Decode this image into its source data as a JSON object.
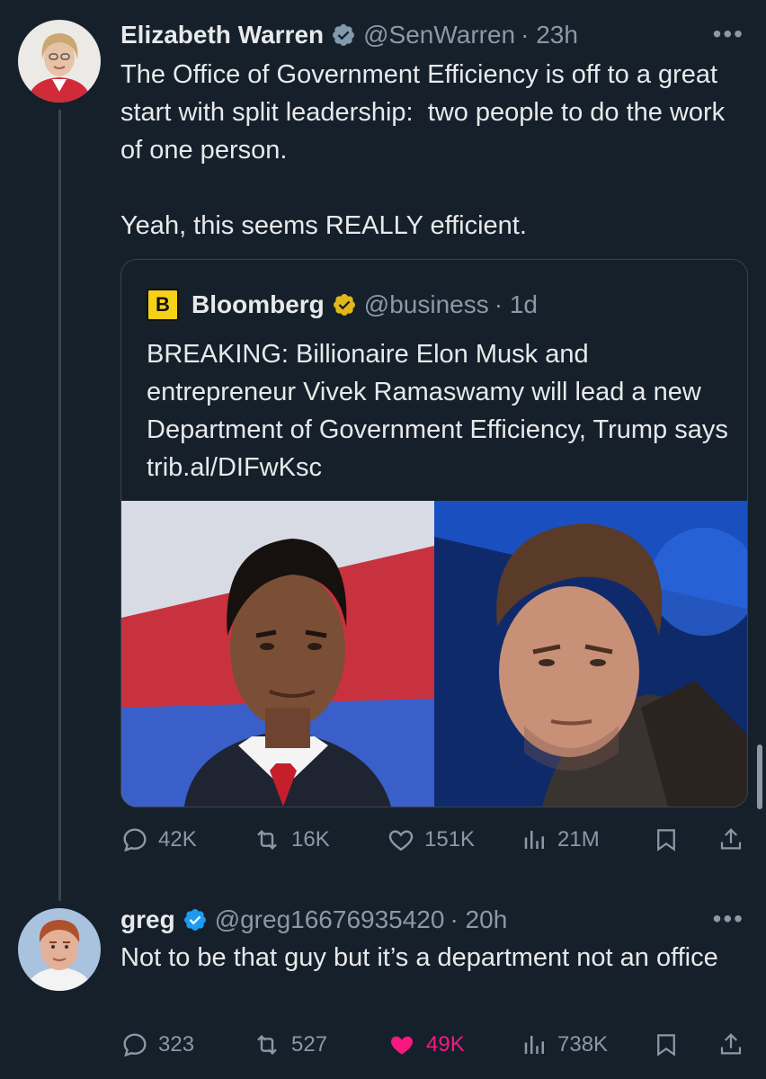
{
  "tweet1": {
    "name": "Elizabeth Warren",
    "handle": "@SenWarren",
    "time": "· 23h",
    "more": "•••",
    "text": "The Office of Government Efficiency is off to a great start with split leadership:  two people to do the work of one person.\n\nYeah, this seems REALLY efficient.",
    "quote": {
      "logo": "B",
      "name": "Bloomberg",
      "handle": "@business",
      "time": "· 1d",
      "text": "BREAKING: Billionaire Elon Musk and entrepreneur Vivek Ramaswamy will lead a new Department of Government Efficiency, Trump says trib.al/DIFwKsc"
    },
    "stats": {
      "replies": "42K",
      "retweets": "16K",
      "likes": "151K",
      "views": "21M"
    }
  },
  "tweet2": {
    "name": "greg",
    "handle": "@greg16676935420",
    "time": "· 20h",
    "more": "•••",
    "text": "Not to be that guy but it’s a department not an office",
    "stats": {
      "replies": "323",
      "retweets": "527",
      "likes": "49K",
      "views": "738K"
    }
  },
  "colors": {
    "background": "#15202b",
    "verified_blue": "#1d9bf0",
    "verified_gold": "#e2b719",
    "like_pink": "#f91880",
    "muted": "#8b98a5"
  }
}
